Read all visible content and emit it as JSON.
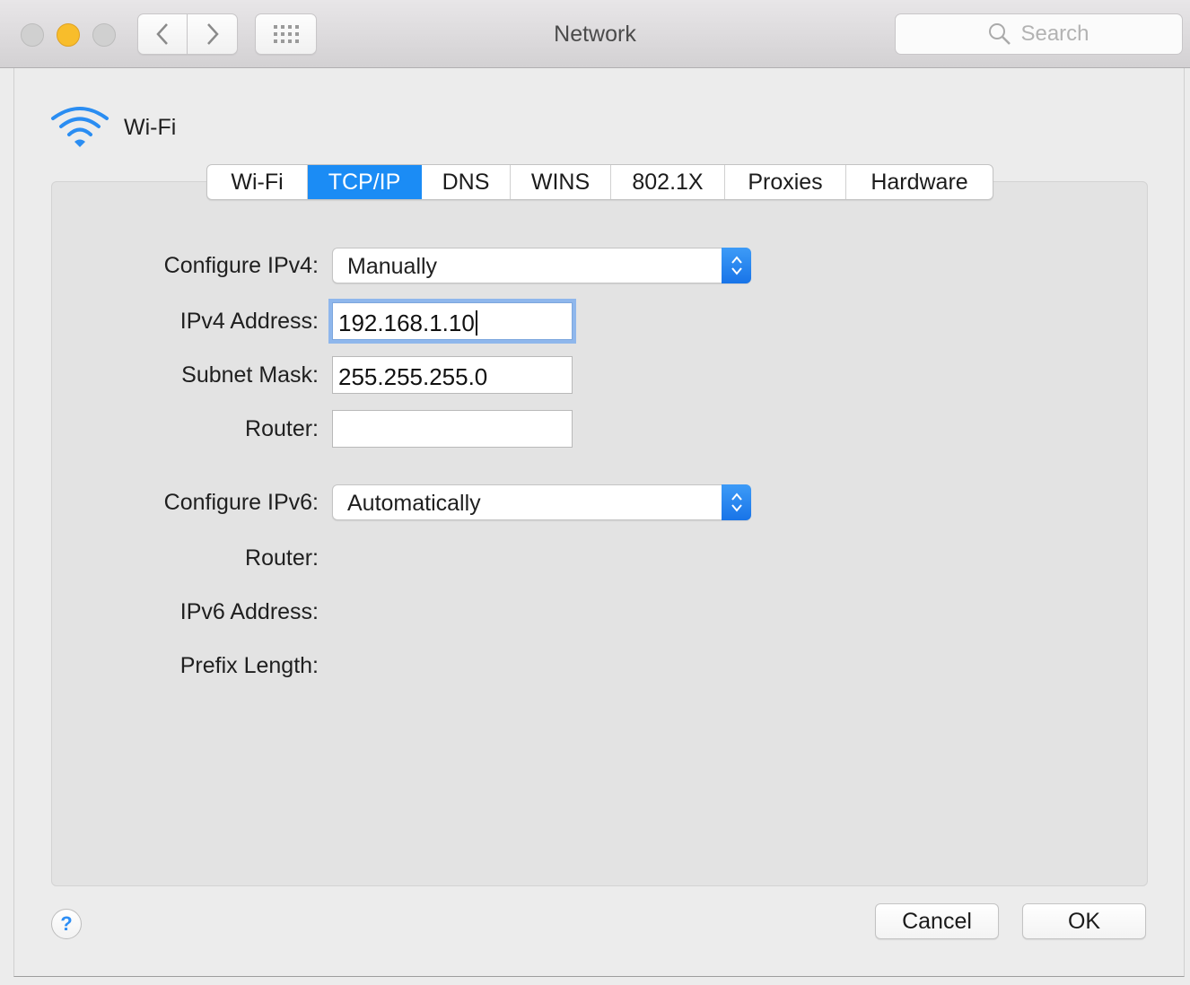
{
  "window": {
    "title": "Network",
    "search_placeholder": "Search"
  },
  "service": {
    "name": "Wi-Fi",
    "icon": "wifi-icon"
  },
  "tabs": [
    {
      "label": "Wi-Fi",
      "active": false
    },
    {
      "label": "TCP/IP",
      "active": true
    },
    {
      "label": "DNS",
      "active": false
    },
    {
      "label": "WINS",
      "active": false
    },
    {
      "label": "802.1X",
      "active": false
    },
    {
      "label": "Proxies",
      "active": false
    },
    {
      "label": "Hardware",
      "active": false
    }
  ],
  "ipv4": {
    "configure_label": "Configure IPv4:",
    "configure_value": "Manually",
    "address_label": "IPv4 Address:",
    "address_value": "192.168.1.10",
    "subnet_label": "Subnet Mask:",
    "subnet_value": "255.255.255.0",
    "router_label": "Router:",
    "router_value": ""
  },
  "ipv6": {
    "configure_label": "Configure IPv6:",
    "configure_value": "Automatically",
    "router_label": "Router:",
    "address_label": "IPv6 Address:",
    "prefix_label": "Prefix Length:"
  },
  "footer": {
    "help_label": "?",
    "cancel_label": "Cancel",
    "ok_label": "OK"
  },
  "colors": {
    "accent": "#1b8cf5",
    "minimize": "#f8bd2b"
  }
}
